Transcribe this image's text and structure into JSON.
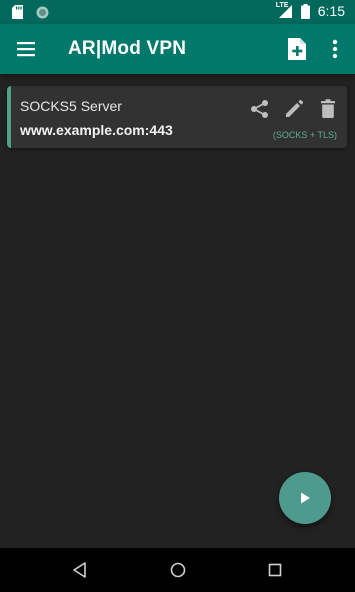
{
  "status_bar": {
    "time": "6:15",
    "network_label": "LTE",
    "icons": [
      "sd-card-icon",
      "sync-icon",
      "signal-icon",
      "battery-icon"
    ]
  },
  "app_bar": {
    "title": "AR|Mod VPN",
    "icons": [
      "menu-icon",
      "add-file-icon",
      "more-vert-icon"
    ]
  },
  "servers": [
    {
      "name": "SOCKS5 Server",
      "address": "www.example.com:443",
      "type": "(SOCKS + TLS)",
      "actions": [
        "share-icon",
        "edit-icon",
        "delete-icon"
      ]
    }
  ],
  "fab": {
    "icon": "play-icon"
  },
  "nav": {
    "icons": [
      "back-icon",
      "home-icon",
      "recents-icon"
    ]
  },
  "colors": {
    "status_bar": "#00695c",
    "app_bar": "#00796b",
    "background": "#222222",
    "card": "#323232",
    "accent": "#4fa085",
    "fab": "#4e9a8c"
  }
}
